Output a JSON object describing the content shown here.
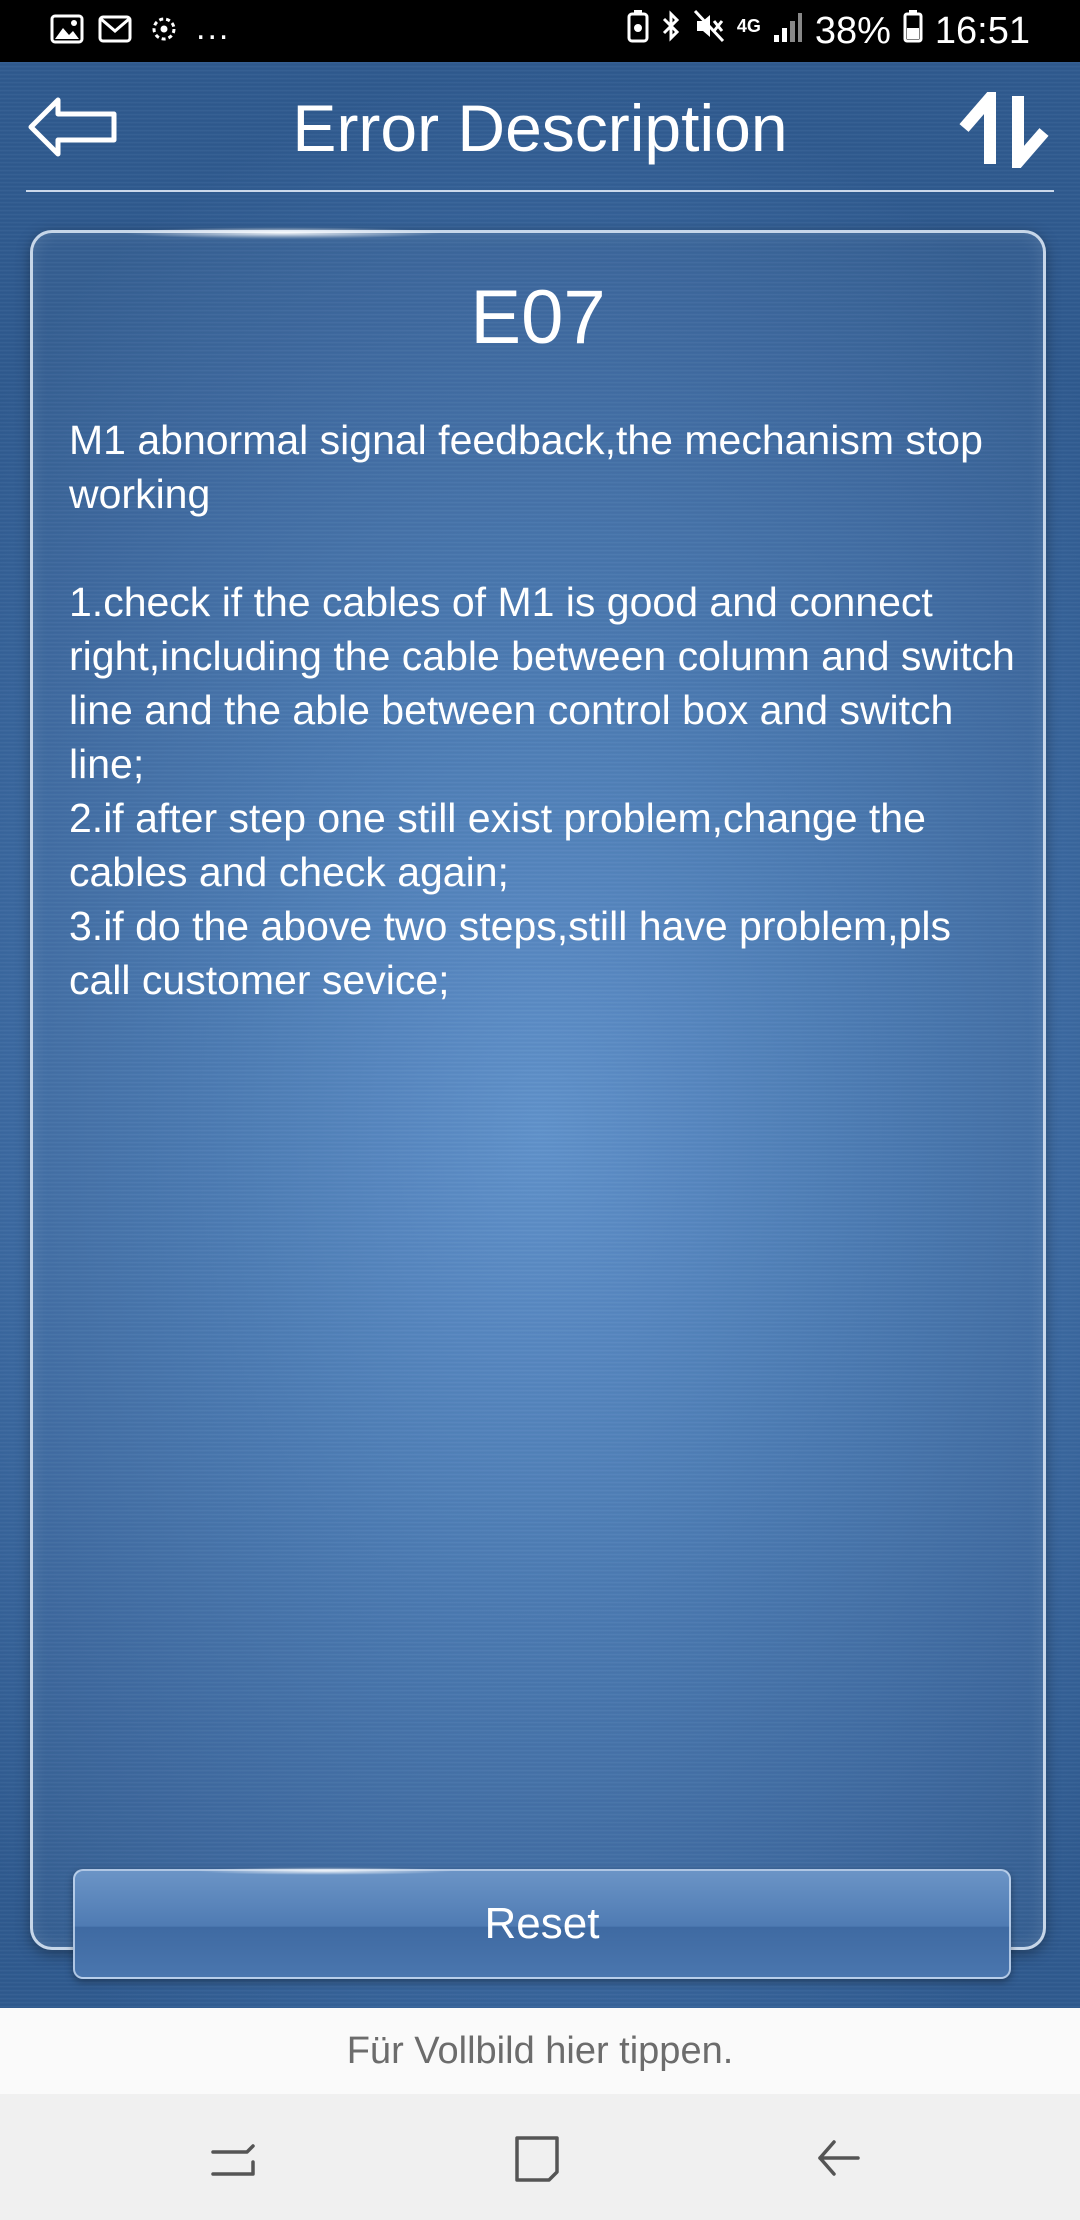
{
  "status_bar": {
    "more_indicator": "...",
    "network_type": "4G",
    "battery_percent": "38%",
    "time": "16:51",
    "left_icons": [
      "gallery-icon",
      "mail-icon",
      "smart-stay-icon"
    ],
    "right_icons": [
      "battery-saver-icon",
      "bluetooth-icon",
      "mute-icon",
      "signal-icon",
      "battery-icon"
    ]
  },
  "header": {
    "title": "Error Description",
    "back_icon": "back-arrow-icon",
    "switch_icon": "switch-arrows-icon"
  },
  "error": {
    "code": "E07",
    "description": "M1 abnormal signal feedback,the mechanism stop working\n\n1.check if the cables of M1 is good and connect right,including the cable between column and switch line and the able between control box and switch line;\n2.if after step one still exist problem,change the cables and check again;\n3.if do the above two steps,still have problem,pls call customer sevice;"
  },
  "actions": {
    "reset_label": "Reset"
  },
  "fullscreen_hint": "Für Vollbild hier tippen.",
  "nav_bar": {
    "buttons": [
      "recent-apps-icon",
      "home-icon",
      "back-icon"
    ]
  },
  "colors": {
    "background_accent": "#4676b0",
    "text": "#ffffff",
    "hint_bar": "#fafafa",
    "nav_bar": "#f0f0f0"
  }
}
